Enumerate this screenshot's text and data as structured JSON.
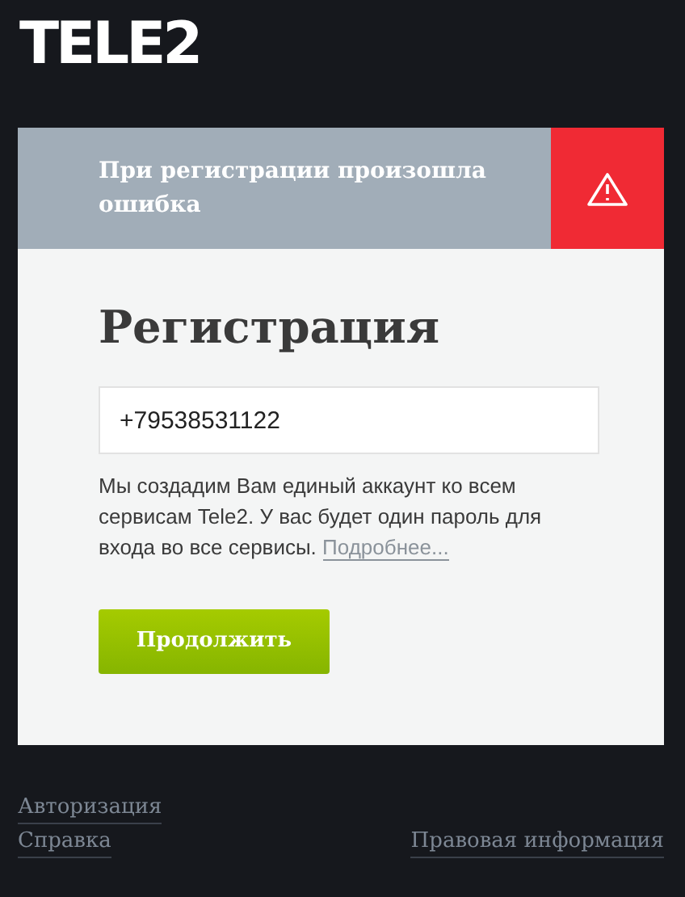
{
  "logo": "TELE2",
  "error_banner": {
    "message": "При регистрации произошла ошибка"
  },
  "form": {
    "title": "Регистрация",
    "phone_value": "+79538531122",
    "info": "Мы создадим Вам единый аккаунт ко всем сервисам Tele2. У вас будет один пароль для входа во все сервисы.",
    "more_link": "Подробнее...",
    "submit": "Продолжить"
  },
  "footer": {
    "left_links": [
      "Авторизация",
      "Справка"
    ],
    "right_link": "Правовая информация"
  }
}
